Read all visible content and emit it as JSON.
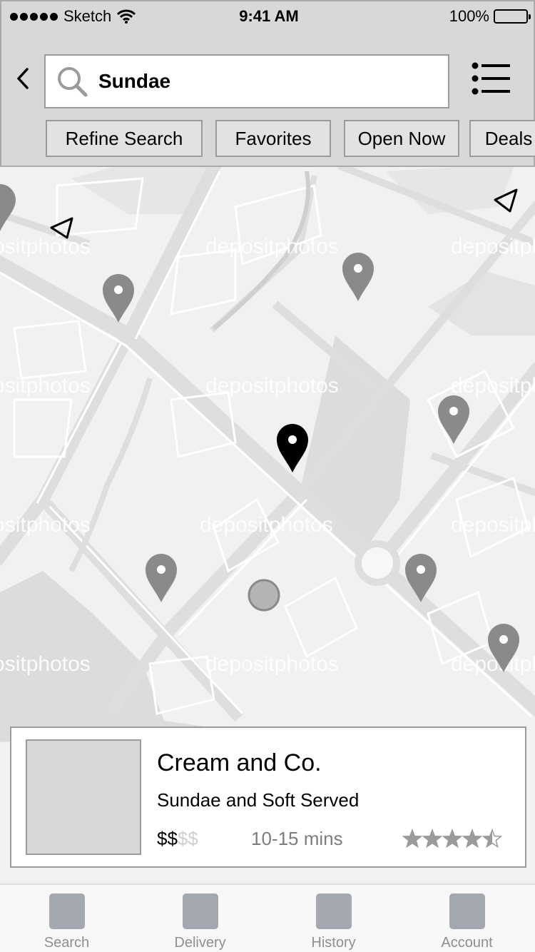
{
  "status_bar": {
    "carrier": "Sketch",
    "time": "9:41 AM",
    "battery": "100%",
    "battery_level": 1.0
  },
  "header": {
    "search_value": "Sundae",
    "back_icon": "chevron-left-icon",
    "search_icon": "magnifier-icon",
    "menu_icon": "list-icon"
  },
  "filters": [
    {
      "label": "Refine Search",
      "active": true
    },
    {
      "label": "Favorites",
      "active": false
    },
    {
      "label": "Open Now",
      "active": false
    },
    {
      "label": "Deals",
      "active": false
    }
  ],
  "map": {
    "watermark": "depositphotos",
    "selected_pin_color": "#000000",
    "pin_color": "#8a8a8a"
  },
  "result_card": {
    "title": "Cream and Co.",
    "subtitle": "Sundae and Soft Served",
    "price_active": "$$",
    "price_inactive": "$$",
    "time": "10-15 mins",
    "rating": 4.5,
    "rating_max": 5
  },
  "tabs": [
    {
      "label": "Search"
    },
    {
      "label": "Delivery"
    },
    {
      "label": "History"
    },
    {
      "label": "Account"
    }
  ],
  "colors": {
    "header_bg": "#d8d8d8",
    "tab_icon": "#a3a8b0",
    "star": "#9b9b9b"
  }
}
